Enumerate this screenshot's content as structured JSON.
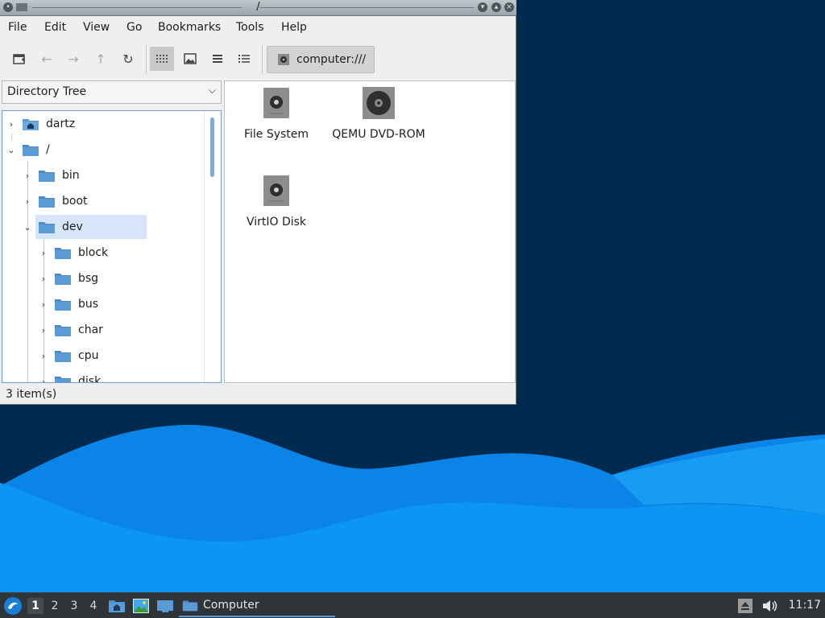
{
  "window": {
    "title": "/",
    "menu": [
      "File",
      "Edit",
      "View",
      "Go",
      "Bookmarks",
      "Tools",
      "Help"
    ],
    "location": "computer:///",
    "side_pane_mode": "Directory Tree",
    "tree": [
      {
        "label": "dartz",
        "icon": "home-folder-icon"
      },
      {
        "label": "/",
        "icon": "folder-icon"
      },
      {
        "label": "bin",
        "icon": "folder-icon"
      },
      {
        "label": "boot",
        "icon": "folder-icon"
      },
      {
        "label": "dev",
        "icon": "folder-icon",
        "selected": true
      },
      {
        "label": "block",
        "icon": "folder-icon"
      },
      {
        "label": "bsg",
        "icon": "folder-icon"
      },
      {
        "label": "bus",
        "icon": "folder-icon"
      },
      {
        "label": "char",
        "icon": "folder-icon"
      },
      {
        "label": "cpu",
        "icon": "folder-icon"
      },
      {
        "label": "disk",
        "icon": "folder-icon"
      }
    ],
    "items": [
      {
        "label": "File System",
        "icon": "drive-icon"
      },
      {
        "label": "QEMU DVD-ROM",
        "icon": "optical-drive-icon"
      },
      {
        "label": "VirtIO Disk",
        "icon": "drive-icon"
      }
    ],
    "status": "3 item(s)"
  },
  "taskbar": {
    "workspaces": [
      "1",
      "2",
      "3",
      "4"
    ],
    "active_workspace": "1",
    "task_label": "Computer",
    "clock": "11:17"
  },
  "colors": {
    "folder": "#5b9bd5",
    "selection": "#d6e6f8",
    "wallpaper_dark": "#022a4e",
    "wallpaper_wave": "#0a8ff0",
    "taskbar": "#2e3437"
  }
}
